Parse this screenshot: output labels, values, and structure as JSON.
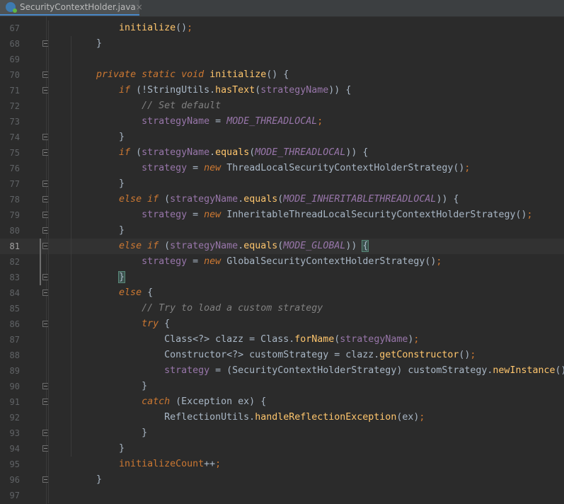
{
  "tab": {
    "filename": "SecurityContextHolder.java",
    "close": "×",
    "icon": "java-class-icon"
  },
  "lines": [
    {
      "n": "67",
      "t": "        initialize();"
    },
    {
      "n": "68",
      "t": "    }"
    },
    {
      "n": "69",
      "t": ""
    },
    {
      "n": "70",
      "t": "    private static void initialize() {"
    },
    {
      "n": "71",
      "t": "        if (!StringUtils.hasText(strategyName)) {"
    },
    {
      "n": "72",
      "t": "            // Set default"
    },
    {
      "n": "73",
      "t": "            strategyName = MODE_THREADLOCAL;"
    },
    {
      "n": "74",
      "t": "        }"
    },
    {
      "n": "75",
      "t": "        if (strategyName.equals(MODE_THREADLOCAL)) {"
    },
    {
      "n": "76",
      "t": "            strategy = new ThreadLocalSecurityContextHolderStrategy();"
    },
    {
      "n": "77",
      "t": "        }"
    },
    {
      "n": "78",
      "t": "        else if (strategyName.equals(MODE_INHERITABLETHREADLOCAL)) {"
    },
    {
      "n": "79",
      "t": "            strategy = new InheritableThreadLocalSecurityContextHolderStrategy();"
    },
    {
      "n": "80",
      "t": "        }"
    },
    {
      "n": "81",
      "t": "        else if (strategyName.equals(MODE_GLOBAL)) {"
    },
    {
      "n": "82",
      "t": "            strategy = new GlobalSecurityContextHolderStrategy();"
    },
    {
      "n": "83",
      "t": "        }"
    },
    {
      "n": "84",
      "t": "        else {"
    },
    {
      "n": "85",
      "t": "            // Try to load a custom strategy"
    },
    {
      "n": "86",
      "t": "            try {"
    },
    {
      "n": "87",
      "t": "                Class<?> clazz = Class.forName(strategyName);"
    },
    {
      "n": "88",
      "t": "                Constructor<?> customStrategy = clazz.getConstructor();"
    },
    {
      "n": "89",
      "t": "                strategy = (SecurityContextHolderStrategy) customStrategy.newInstance();"
    },
    {
      "n": "90",
      "t": "            }"
    },
    {
      "n": "91",
      "t": "            catch (Exception ex) {"
    },
    {
      "n": "92",
      "t": "                ReflectionUtils.handleReflectionException(ex);"
    },
    {
      "n": "93",
      "t": "            }"
    },
    {
      "n": "94",
      "t": "        }"
    },
    {
      "n": "95",
      "t": "        initializeCount++;"
    },
    {
      "n": "96",
      "t": "    }"
    },
    {
      "n": "97",
      "t": ""
    }
  ],
  "current_line": "81",
  "colors": {
    "background": "#2b2b2b",
    "keyword": "#cc7832",
    "method": "#ffc66d",
    "field": "#9876aa",
    "comment": "#808080",
    "text": "#a9b7c6"
  }
}
